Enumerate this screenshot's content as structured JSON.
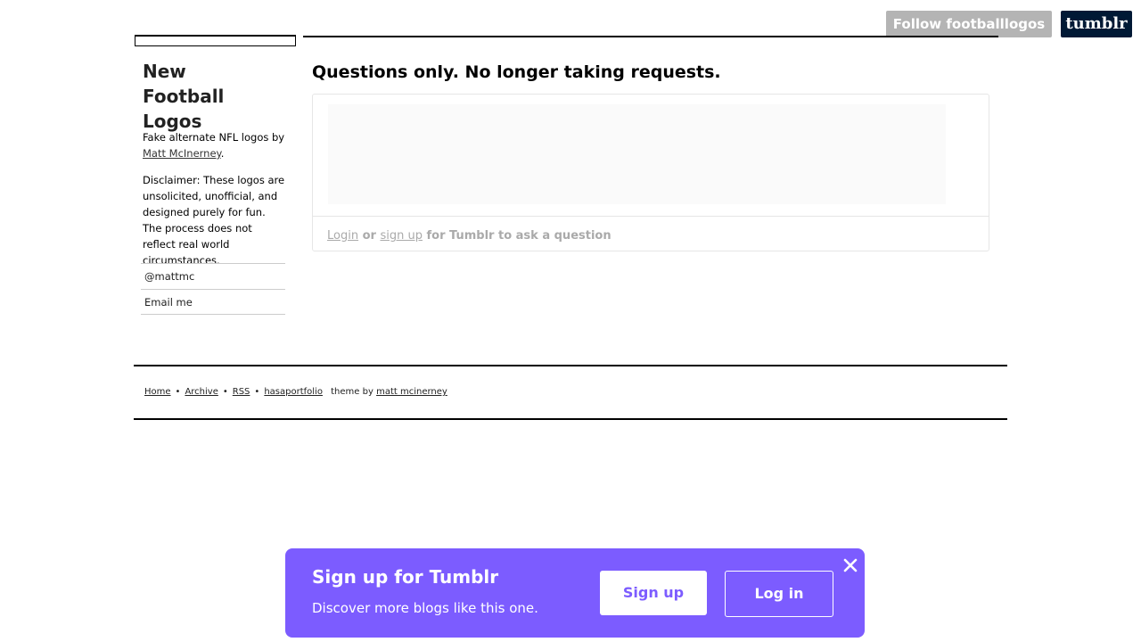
{
  "header": {
    "follow_label": "Follow footballlogos",
    "tumblr_logo_text": "tumblr"
  },
  "sidebar": {
    "title": "New Football Logos",
    "description_prefix": "Fake alternate NFL logos by",
    "author_link": "Matt McInerney",
    "description_suffix": ".",
    "disclaimer": "Disclaimer: These logos are unsolicited, unofficial, and designed purely for fun. The process does not reflect real world circumstances.",
    "links": [
      "@mattmc",
      "Email me"
    ]
  },
  "main": {
    "heading": "Questions only. No longer taking requests.",
    "ask": {
      "login_label": "Login",
      "or_text": "or",
      "signup_label": "sign up",
      "suffix_text": "for Tumblr to ask a question"
    }
  },
  "footer": {
    "links": [
      "Home",
      "Archive",
      "RSS",
      "hasaportfolio"
    ],
    "separator": "•",
    "theme_text": "theme by",
    "theme_author": "matt mcinerney"
  },
  "banner": {
    "title": "Sign up for Tumblr",
    "subtitle": "Discover more blogs like this one.",
    "signup_label": "Sign up",
    "login_label": "Log in",
    "close_icon": "close-icon",
    "accent_color": "#7c5cff"
  }
}
